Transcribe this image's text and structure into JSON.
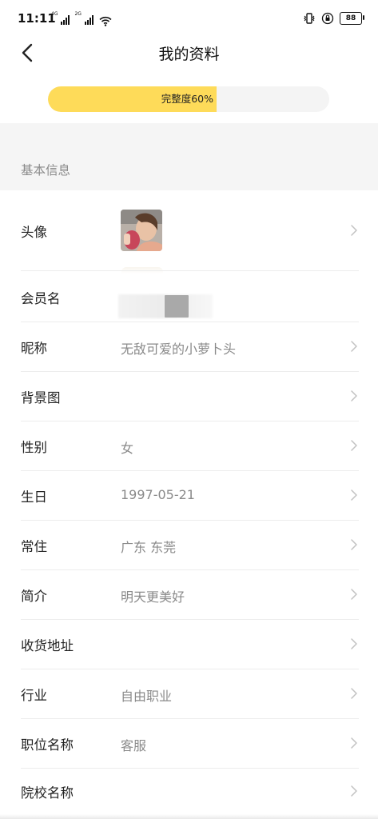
{
  "status_bar": {
    "time": "11:11",
    "signal_1_label": "4G",
    "signal_2_label": "2G",
    "battery": "88",
    "icons": [
      "signal-icon",
      "signal-icon",
      "wifi-icon",
      "vibrate-icon",
      "rotation-lock-icon",
      "battery-icon"
    ]
  },
  "header": {
    "title": "我的资料",
    "back_icon": "chevron-left-icon"
  },
  "completeness": {
    "label": "完整度60%",
    "percent": 60,
    "fill_color": "#fedb59",
    "track_color": "#f4f4f4"
  },
  "section": {
    "title": "基本信息"
  },
  "profile": {
    "avatar_label": "头像",
    "member_name_label": "会员名",
    "nickname_label": "昵称",
    "nickname_value": "无敌可爱的小萝卜头",
    "background_label": "背景图",
    "gender_label": "性别",
    "gender_value": "女",
    "birthday_label": "生日",
    "birthday_value": "1997-05-21",
    "residence_label": "常住",
    "residence_value": "广东 东莞",
    "bio_label": "简介",
    "bio_value": "明天更美好",
    "address_label": "收货地址",
    "industry_label": "行业",
    "industry_value": "自由职业",
    "job_title_label": "职位名称",
    "job_title_value": "客服",
    "school_label": "院校名称"
  },
  "colors": {
    "accent": "#fedb59",
    "secondary_text": "#8a8a8a",
    "section_bg": "#f5f5f5"
  }
}
